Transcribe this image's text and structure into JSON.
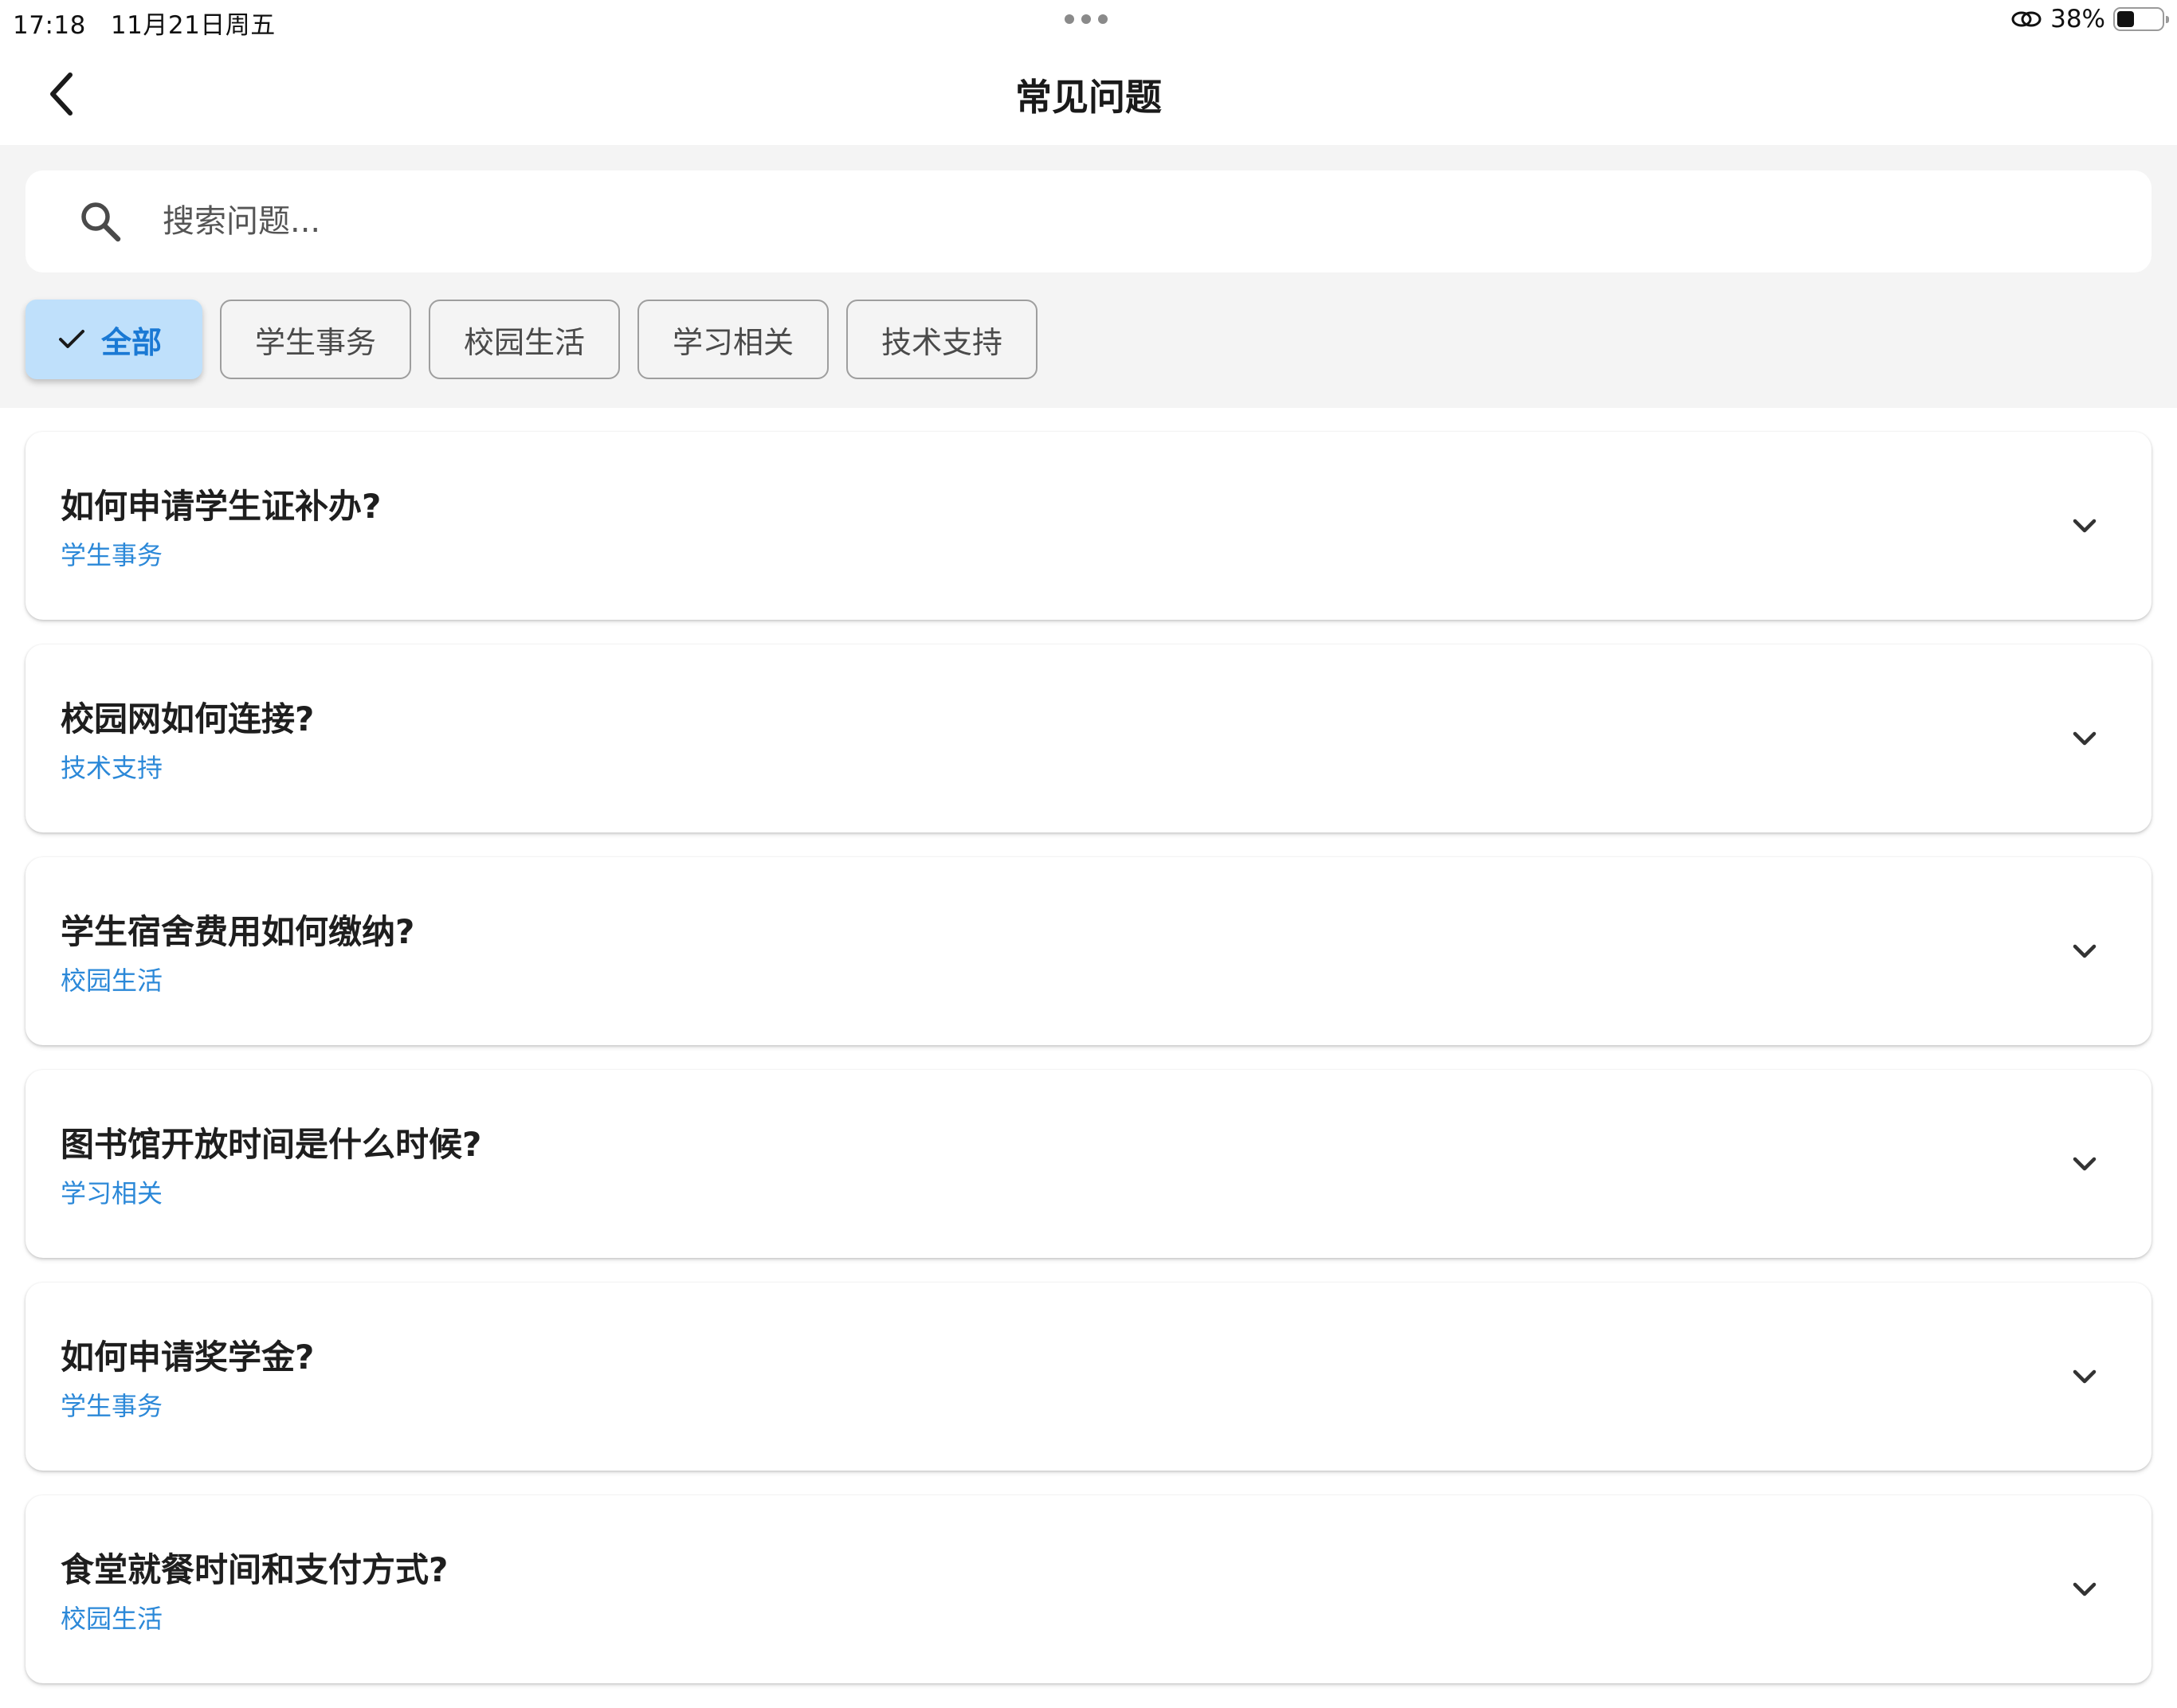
{
  "status_bar": {
    "time": "17:18",
    "date": "11月21日周五",
    "battery_percent": "38%",
    "battery_level": 0.38
  },
  "header": {
    "title": "常见问题",
    "back_icon": "chevron-left-icon"
  },
  "search": {
    "placeholder": "搜索问题...",
    "value": "",
    "icon": "search-icon"
  },
  "filters": [
    {
      "label": "全部",
      "selected": true
    },
    {
      "label": "学生事务",
      "selected": false
    },
    {
      "label": "校园生活",
      "selected": false
    },
    {
      "label": "学习相关",
      "selected": false
    },
    {
      "label": "技术支持",
      "selected": false
    }
  ],
  "faqs": [
    {
      "question": "如何申请学生证补办?",
      "category": "学生事务"
    },
    {
      "question": "校园网如何连接?",
      "category": "技术支持"
    },
    {
      "question": "学生宿舍费用如何缴纳?",
      "category": "校园生活"
    },
    {
      "question": "图书馆开放时间是什么时候?",
      "category": "学习相关"
    },
    {
      "question": "如何申请奖学金?",
      "category": "学生事务"
    },
    {
      "question": "食堂就餐时间和支付方式?",
      "category": "校园生活"
    }
  ],
  "colors": {
    "accent": "#2b88d8",
    "chip_selected_bg": "#bfe0fb",
    "filter_bg": "#f4f4f4"
  }
}
